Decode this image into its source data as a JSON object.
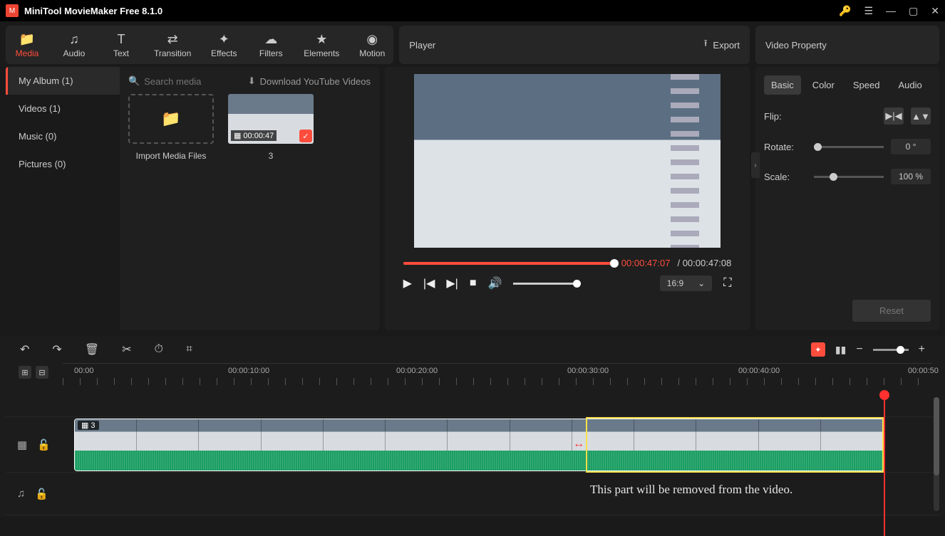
{
  "app": {
    "title": "MiniTool MovieMaker Free 8.1.0"
  },
  "toolbar": {
    "media": "Media",
    "audio": "Audio",
    "text": "Text",
    "transition": "Transition",
    "effects": "Effects",
    "filters": "Filters",
    "elements": "Elements",
    "motion": "Motion"
  },
  "playerHeader": {
    "title": "Player",
    "export": "Export"
  },
  "propHeader": {
    "title": "Video Property"
  },
  "sidebar": {
    "items": [
      {
        "label": "My Album (1)"
      },
      {
        "label": "Videos (1)"
      },
      {
        "label": "Music (0)"
      },
      {
        "label": "Pictures (0)"
      }
    ]
  },
  "mediaPanel": {
    "searchPlaceholder": "Search media",
    "downloadLabel": "Download YouTube Videos",
    "importLabel": "Import Media Files",
    "clip": {
      "duration": "00:00:47",
      "name": "3"
    }
  },
  "player": {
    "time_current": "00:00:47:07",
    "time_total": "00:00:47:08",
    "sep": " / ",
    "ratio": "16:9"
  },
  "props": {
    "tabs": {
      "basic": "Basic",
      "color": "Color",
      "speed": "Speed",
      "audio": "Audio"
    },
    "flip": "Flip:",
    "rotate": "Rotate:",
    "rotate_val": "0 °",
    "scale": "Scale:",
    "scale_val": "100 %",
    "reset": "Reset"
  },
  "ruler": {
    "t0": "00:00",
    "t1": "00:00:10:00",
    "t2": "00:00:20:00",
    "t3": "00:00:30:00",
    "t4": "00:00:40:00",
    "t5": "00:00:50"
  },
  "clip": {
    "name": "3"
  },
  "annotation": "This part will be removed from the video."
}
